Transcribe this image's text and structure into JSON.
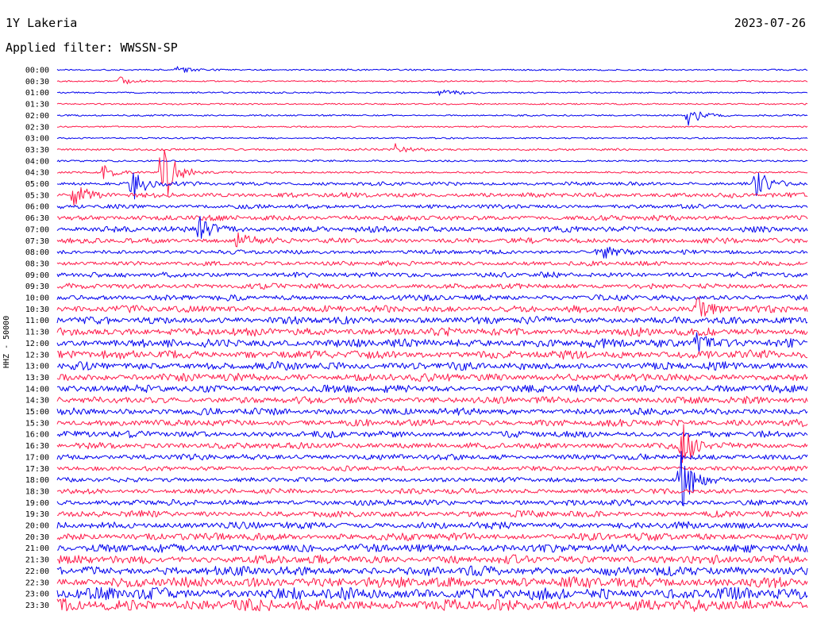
{
  "header": {
    "station": "1Y Lakeria",
    "date": "2023-07-26",
    "filter": "Applied filter: WWSSN-SP"
  },
  "chart_data": {
    "type": "line",
    "ylabel": "HHZ - 50000",
    "colors": {
      "line_a": "#0000ee",
      "line_b": "#ff1a4a"
    },
    "row_colors": [
      "line_a",
      "line_b"
    ],
    "rows": [
      {
        "time": "00:00",
        "level": 0.05
      },
      {
        "time": "00:30",
        "level": 0.05
      },
      {
        "time": "01:00",
        "level": 0.05
      },
      {
        "time": "01:30",
        "level": 0.06
      },
      {
        "time": "02:00",
        "level": 0.06
      },
      {
        "time": "02:30",
        "level": 0.05
      },
      {
        "time": "03:00",
        "level": 0.06
      },
      {
        "time": "03:30",
        "level": 0.12
      },
      {
        "time": "04:00",
        "level": 0.08
      },
      {
        "time": "04:30",
        "level": 0.1
      },
      {
        "time": "05:00",
        "level": 0.25
      },
      {
        "time": "05:30",
        "level": 0.35
      },
      {
        "time": "06:00",
        "level": 0.3
      },
      {
        "time": "06:30",
        "level": 0.4
      },
      {
        "time": "07:00",
        "level": 0.45
      },
      {
        "time": "07:30",
        "level": 0.4
      },
      {
        "time": "08:00",
        "level": 0.3
      },
      {
        "time": "08:30",
        "level": 0.35
      },
      {
        "time": "09:00",
        "level": 0.4
      },
      {
        "time": "09:30",
        "level": 0.4
      },
      {
        "time": "10:00",
        "level": 0.45
      },
      {
        "time": "10:30",
        "level": 0.55
      },
      {
        "time": "11:00",
        "level": 0.6
      },
      {
        "time": "11:30",
        "level": 0.65
      },
      {
        "time": "12:00",
        "level": 0.7
      },
      {
        "time": "12:30",
        "level": 0.7
      },
      {
        "time": "13:00",
        "level": 0.65
      },
      {
        "time": "13:30",
        "level": 0.65
      },
      {
        "time": "14:00",
        "level": 0.6
      },
      {
        "time": "14:30",
        "level": 0.55
      },
      {
        "time": "15:00",
        "level": 0.55
      },
      {
        "time": "15:30",
        "level": 0.55
      },
      {
        "time": "16:00",
        "level": 0.5
      },
      {
        "time": "16:30",
        "level": 0.5
      },
      {
        "time": "17:00",
        "level": 0.45
      },
      {
        "time": "17:30",
        "level": 0.35
      },
      {
        "time": "18:00",
        "level": 0.35
      },
      {
        "time": "18:30",
        "level": 0.4
      },
      {
        "time": "19:00",
        "level": 0.45
      },
      {
        "time": "19:30",
        "level": 0.5
      },
      {
        "time": "20:00",
        "level": 0.55
      },
      {
        "time": "20:30",
        "level": 0.6
      },
      {
        "time": "21:00",
        "level": 0.65
      },
      {
        "time": "21:30",
        "level": 0.7
      },
      {
        "time": "22:00",
        "level": 0.8
      },
      {
        "time": "22:30",
        "level": 0.9
      },
      {
        "time": "23:00",
        "level": 1.0
      },
      {
        "time": "23:30",
        "level": 1.0
      }
    ],
    "events": [
      {
        "time": "00:00",
        "position": 0.16,
        "amplitude": 0.35
      },
      {
        "time": "00:30",
        "position": 0.08,
        "amplitude": 0.45
      },
      {
        "time": "01:00",
        "position": 0.51,
        "amplitude": 0.55
      },
      {
        "time": "02:00",
        "position": 0.84,
        "amplitude": 0.9
      },
      {
        "time": "03:30",
        "position": 0.45,
        "amplitude": 0.5
      },
      {
        "time": "04:30",
        "position": 0.06,
        "amplitude": 0.7
      },
      {
        "time": "04:30",
        "position": 0.14,
        "amplitude": 3.2
      },
      {
        "time": "05:00",
        "position": 0.1,
        "amplitude": 1.6
      },
      {
        "time": "05:00",
        "position": 0.93,
        "amplitude": 1.4
      },
      {
        "time": "05:30",
        "position": 0.02,
        "amplitude": 1.2
      },
      {
        "time": "07:00",
        "position": 0.19,
        "amplitude": 1.1
      },
      {
        "time": "07:30",
        "position": 0.24,
        "amplitude": 1.0
      },
      {
        "time": "08:00",
        "position": 0.72,
        "amplitude": 0.8
      },
      {
        "time": "10:30",
        "position": 0.85,
        "amplitude": 1.2
      },
      {
        "time": "12:00",
        "position": 0.85,
        "amplitude": 1.0
      },
      {
        "time": "16:30",
        "position": 0.83,
        "amplitude": 2.2
      },
      {
        "time": "18:00",
        "position": 0.83,
        "amplitude": 3.0
      }
    ]
  }
}
